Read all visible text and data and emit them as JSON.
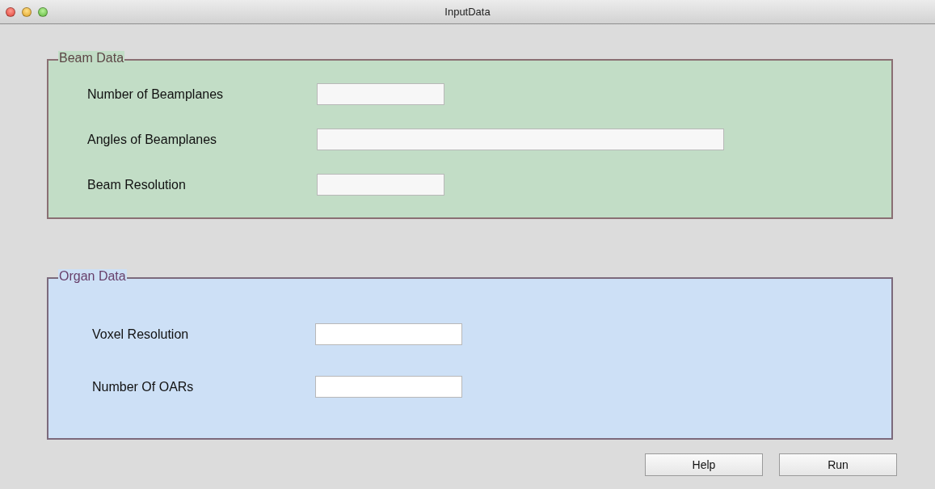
{
  "window": {
    "title": "InputData"
  },
  "panels": [
    {
      "title": "Beam Data",
      "fields": [
        {
          "label": "Number of Beamplanes",
          "kind": "short"
        },
        {
          "label": "Angles of Beamplanes",
          "kind": "long"
        },
        {
          "label": "Beam Resolution",
          "kind": "short"
        }
      ]
    },
    {
      "title": "Organ Data",
      "fields": [
        {
          "label": "Voxel Resolution",
          "kind": "medium"
        },
        {
          "label": "Number Of OARs",
          "kind": "medium"
        }
      ]
    }
  ],
  "buttons": [
    "Help",
    "Run"
  ]
}
